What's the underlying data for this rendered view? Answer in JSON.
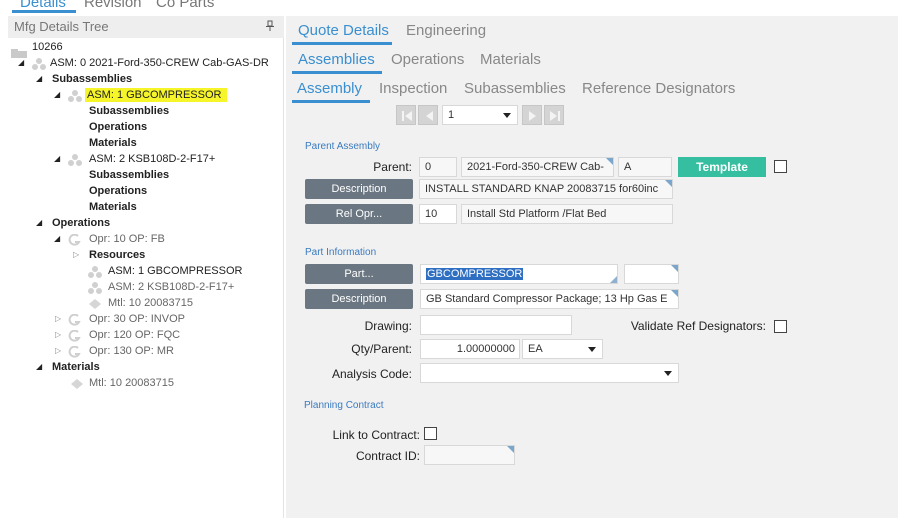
{
  "top_tabs": [
    "Details",
    "Revision",
    "Co Parts"
  ],
  "tree": {
    "title": "Mfg Details Tree",
    "nodes": {
      "root": "10266",
      "asm0": "ASM: 0 2021-Ford-350-CREW Cab-GAS-DR",
      "subassemblies": "Subassemblies",
      "asm1": "ASM: 1 GBCOMPRESSOR",
      "asm1_sub": "Subassemblies",
      "asm1_ops": "Operations",
      "asm1_mat": "Materials",
      "asm2": "ASM: 2 KSB108D-2-F17+",
      "asm2_sub": "Subassemblies",
      "asm2_ops": "Operations",
      "asm2_mat": "Materials",
      "operations": "Operations",
      "opr10": "Opr: 10 OP: FB",
      "resources": "Resources",
      "res_asm1": "ASM: 1 GBCOMPRESSOR",
      "res_asm2": "ASM: 2 KSB108D-2-F17+",
      "res_mtl": "Mtl: 10 20083715",
      "opr30": "Opr: 30 OP: INVOP",
      "opr120": "Opr: 120 OP: FQC",
      "opr130": "Opr: 130 OP: MR",
      "materials": "Materials",
      "mtl10": "Mtl: 10 20083715"
    }
  },
  "tabs_row1": [
    "Quote Details",
    "Engineering"
  ],
  "tabs_row2": [
    "Assemblies",
    "Operations",
    "Materials"
  ],
  "tabs_row3": [
    "Assembly",
    "Inspection",
    "Subassemblies",
    "Reference Designators"
  ],
  "nav": {
    "page_value": "1"
  },
  "parent_assembly": {
    "section": "Parent Assembly",
    "parent_label": "Parent:",
    "parent_seq": "0",
    "parent_part": "2021-Ford-350-CREW Cab-",
    "parent_rev": "A",
    "template_button": "Template",
    "description_button": "Description",
    "description_value": "INSTALL  STANDARD  KNAP   20083715 for60inc",
    "relopr_button": "Rel Opr...",
    "relopr_value": "10",
    "relopr_desc": "Install Std Platform /Flat Bed"
  },
  "part_information": {
    "section": "Part Information",
    "part_button": "Part...",
    "part_value": "GBCOMPRESSOR",
    "rev_value": "",
    "description_button": "Description",
    "description_value": "GB Standard Compressor Package; 13 Hp Gas  E",
    "drawing_label": "Drawing:",
    "drawing_value": "",
    "validate_label": "Validate Ref Designators:",
    "qty_label": "Qty/Parent:",
    "qty_value": "1.00000000",
    "uom_value": "EA",
    "analysis_label": "Analysis Code:",
    "analysis_value": ""
  },
  "planning_contract": {
    "section": "Planning Contract",
    "link_label": "Link to Contract:",
    "contract_label": "Contract ID:",
    "contract_value": ""
  },
  "colors": {
    "accent": "#3a8fd0",
    "button_gray": "#6a7681",
    "template_green": "#35bfa0",
    "highlight": "#f5f52a"
  }
}
